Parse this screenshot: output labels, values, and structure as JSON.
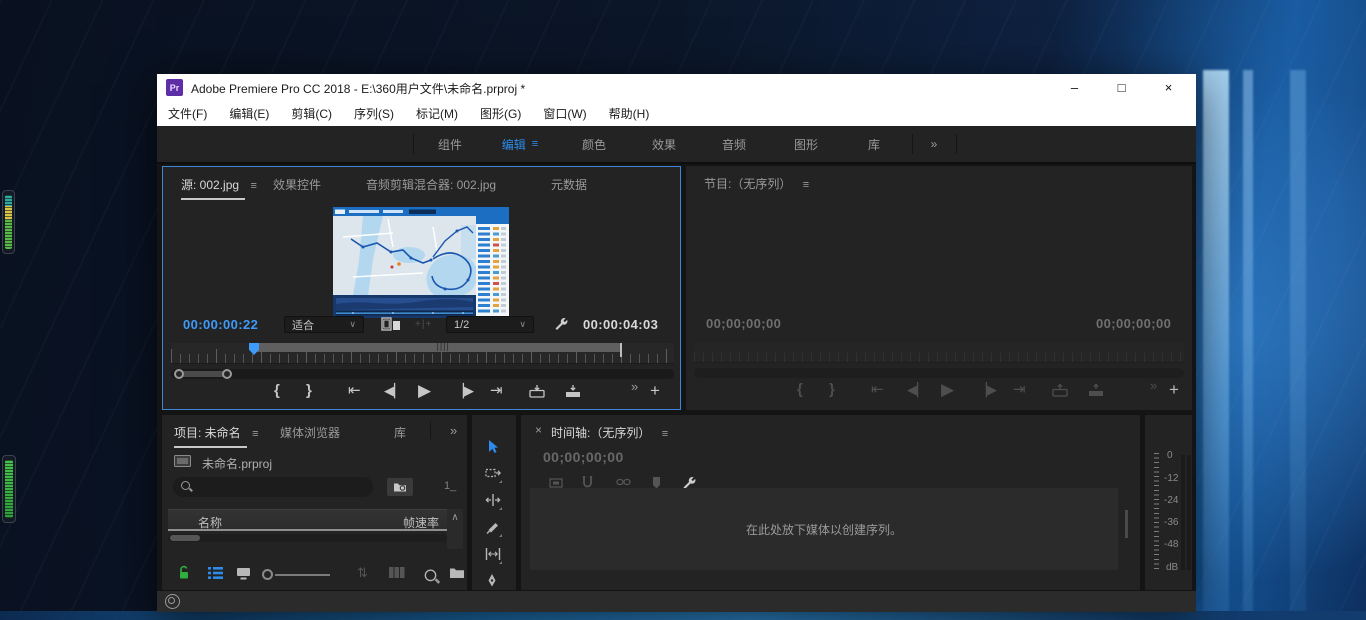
{
  "window": {
    "app_icon_text": "Pr",
    "title": "Adobe Premiere Pro CC 2018 - E:\\360用户文件\\未命名.prproj *",
    "menus": [
      "文件(F)",
      "编辑(E)",
      "剪辑(C)",
      "序列(S)",
      "标记(M)",
      "图形(G)",
      "窗口(W)",
      "帮助(H)"
    ]
  },
  "workspace_bar": {
    "tabs": [
      "组件",
      "编辑",
      "颜色",
      "效果",
      "音频",
      "图形",
      "库"
    ],
    "active_tab": "编辑"
  },
  "source_monitor": {
    "tab_source": "源: 002.jpg",
    "tab_effect_controls": "效果控件",
    "tab_audio_mixer": "音频剪辑混合器: 002.jpg",
    "tab_metadata": "元数据",
    "current_time": "00:00:00:22",
    "zoom_level": "适合",
    "playback_resolution": "1/2",
    "duration": "00:00:04:03"
  },
  "program_monitor": {
    "tab": "节目:（无序列）",
    "position_time": "00;00;00;00",
    "duration_time": "00;00;00;00"
  },
  "project_panel": {
    "tab_project": "项目: 未命名",
    "tab_media_browser": "媒体浏览器",
    "tab_libraries": "库",
    "project_file": "未命名.prproj",
    "count_text": "1_",
    "col_name": "名称",
    "col_frame_rate": "帧速率"
  },
  "timeline_panel": {
    "tab": "时间轴:（无序列）",
    "timecode": "00;00;00;00",
    "drop_hint": "在此处放下媒体以创建序列。"
  },
  "audio_meter": {
    "labels": [
      "0",
      "-12",
      "-24",
      "-36",
      "-48",
      "dB"
    ]
  },
  "glyphs": {
    "hamburger": "≡",
    "overflow": "»",
    "chevron_down": "∨",
    "chevron_up": "∧",
    "close": "×",
    "minimize": "–",
    "maximize": "□",
    "mark_in": "{",
    "mark_out": "}",
    "go_to_in": "⇤",
    "step_back": "◀▏",
    "play": "▶",
    "step_forward": "▕▶",
    "go_to_out": "⇥",
    "plus": "+",
    "sort": "⇅",
    "plus_bar_plus": "+|+"
  },
  "colors": {
    "accent_blue": "#2d8ceb",
    "timecode_blue": "#3f9bfa",
    "lock_green": "#2fae3f",
    "panel_bg": "#232323",
    "title_bar": "#ffffff"
  }
}
